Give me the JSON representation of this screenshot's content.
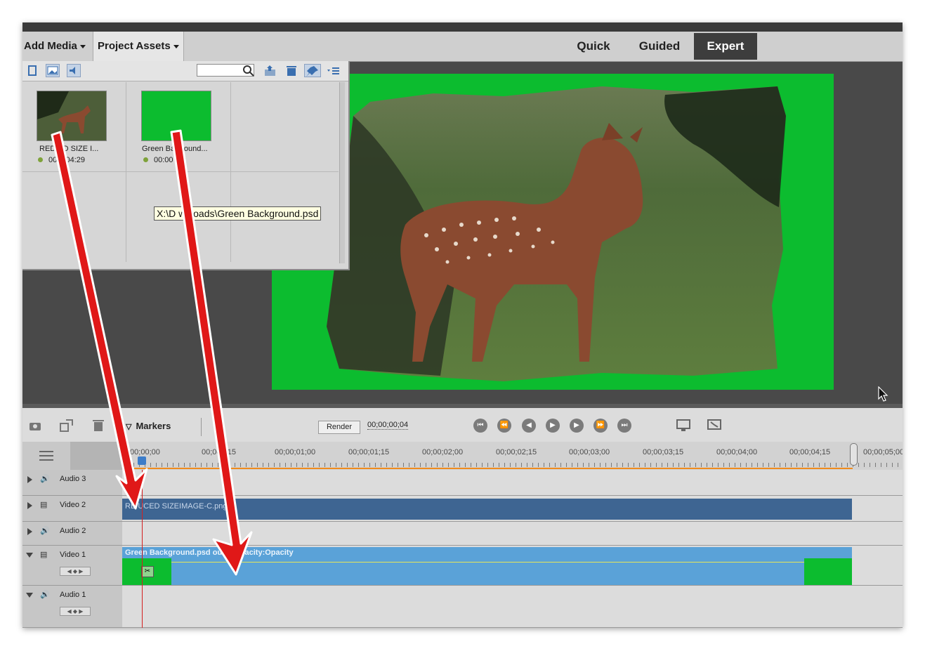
{
  "menu": {
    "add_media": "Add Media",
    "project_assets": "Project Assets"
  },
  "modes": {
    "quick": "Quick",
    "guided": "Guided",
    "expert": "Expert"
  },
  "assets": [
    {
      "name": "RED  ED SIZE I...",
      "duration": "00   0:04:29"
    },
    {
      "name": "Green Ba  ground...",
      "duration": "00:00    :29"
    }
  ],
  "tooltip": "X:\\D   wnloads\\Green Background.psd",
  "timeline": {
    "markers_label": "Markers",
    "render_label": "Render",
    "timecode": "00;00;00;04",
    "ruler": [
      "  ;00;00;00",
      "00;00;  ;15",
      "00;00;01;00",
      "00;00;01;15",
      "00;00;02;00",
      "00;00;02;15",
      "00;00;03;00",
      "00;00;03;15",
      "00;00;04;00",
      "00;00;04;15",
      "00;00;05;00"
    ],
    "tracks": [
      "Audio 3",
      "Video 2",
      "Audio 2",
      "Video 1",
      "Audio 1"
    ],
    "clip_video2": "RE  UCED SIZEIMAGE-C.png",
    "clip_video1": "Green Background.psd   ound:Opacity:Opacity"
  },
  "colors": {
    "chroma_green": "#0cbc2f",
    "clip_dark": "#3e6592",
    "clip_light": "#5aa2d8",
    "annotation_red": "#e01818"
  },
  "icons": [
    "film-icon",
    "image-icon",
    "audio-icon",
    "search-icon",
    "folder-up-icon",
    "trash-icon",
    "pin-icon",
    "list-menu-icon",
    "camera-icon",
    "rotate-icon",
    "marker-icon",
    "play-icon",
    "cursor-icon"
  ]
}
